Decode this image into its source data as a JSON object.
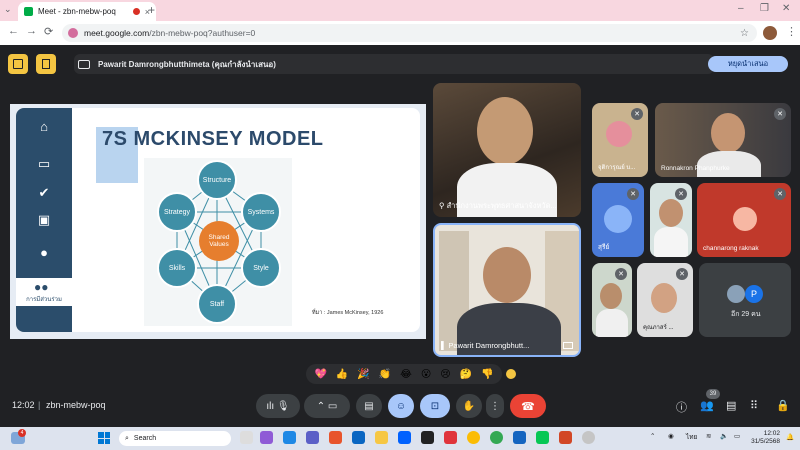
{
  "browser": {
    "tab_title": "Meet - zbn-mebw-poq",
    "close_tab": "×",
    "new_tab": "+",
    "url_domain": "meet.google.com",
    "url_path": "/zbn-mebw-poq?authuser=0",
    "nav": {
      "back": "←",
      "forward": "→",
      "reload": "⟳"
    },
    "bookmark": "☆",
    "menu": "⋮",
    "window": {
      "minimize": "–",
      "maximize": "❐",
      "close": "✕"
    }
  },
  "presenting_bar": {
    "text": "Pawarit Damrongbhutthimeta (คุณกำลังนำเสนอ)",
    "stop_label": "หยุดนำเสนอ"
  },
  "slide": {
    "title": "7S MCKINSEY MODEL",
    "rail_tab_label": "การมีส่วนร่วม",
    "nodes": [
      "Structure",
      "Strategy",
      "Systems",
      "Skills",
      "Style",
      "Staff"
    ],
    "center": "Shared Values",
    "source": "ที่มา : James McKinsey, 1926"
  },
  "tiles": {
    "main_top_label": "สำนักงานพระพุทธศาสนาจังหวัด...",
    "main_bottom_label": "Pawarit Damrongbhutt...",
    "t1_label": "จุติการุณย์ บ...",
    "t2_label": "Ronnakron Phanphurke",
    "t3_label": "สุรีย์",
    "t4_label": "channarong raknak",
    "t5_label": "คุณภาสร์ ...",
    "others_label": "อีก 29 คน",
    "others_initial": "P"
  },
  "controls": {
    "time": "12:02",
    "separator": "|",
    "meeting_code": "zbn-mebw-poq",
    "participants_count": "39"
  },
  "reactions": [
    "💖",
    "👍",
    "🎉",
    "👏",
    "😂",
    "😮",
    "😢",
    "🤔",
    "👎"
  ],
  "taskbar": {
    "search_placeholder": "Search",
    "lang": "ไทย",
    "clock_time": "12:02",
    "clock_date": "31/5/2568",
    "notification_count": "4"
  },
  "colors": {
    "accent": "#a8c7fa",
    "end_call": "#ea4335",
    "node": "#3f8fa6",
    "center": "#e67e2e"
  }
}
